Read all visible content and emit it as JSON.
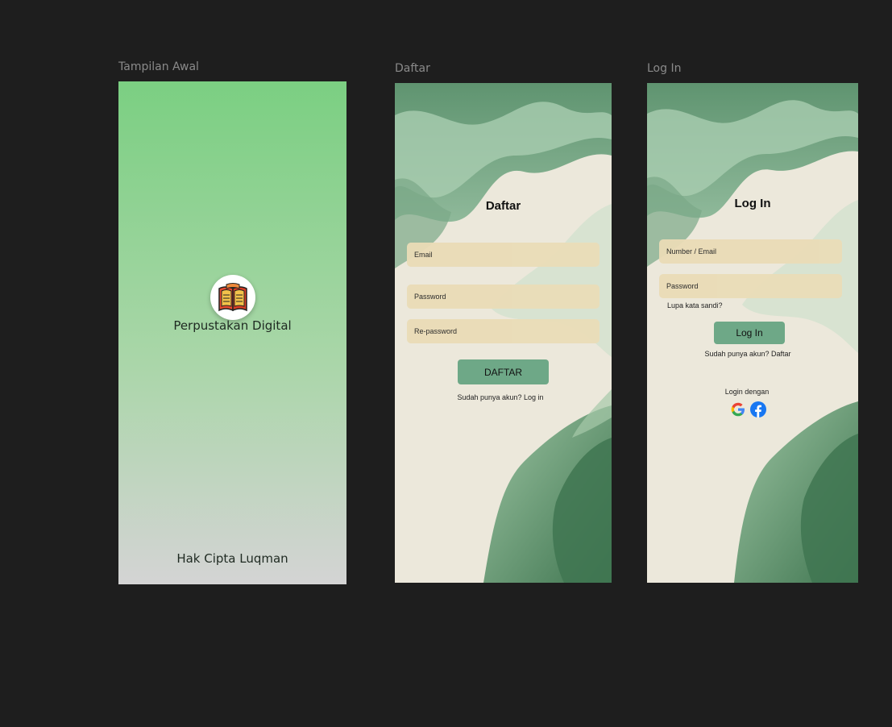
{
  "frames": {
    "splash": {
      "label": "Tampilan Awal",
      "app_name": "Perpustakan Digital",
      "footer": "Hak Cipta Luqman",
      "logo_icon": "book-icon"
    },
    "daftar": {
      "label": "Daftar",
      "title": "Daftar",
      "email_placeholder": "Email",
      "password_placeholder": "Password",
      "repassword_placeholder": "Re-password",
      "submit_label": "DAFTAR",
      "login_link": "Sudah punya akun? Log in"
    },
    "login": {
      "label": "Log In",
      "title": "Log In",
      "identifier_placeholder": "Number / Email",
      "password_placeholder": "Password",
      "forgot_link": "Lupa kata sandi?",
      "submit_label": "Log In",
      "register_link": "Sudah punya akun? Daftar",
      "social_label": "Login dengan",
      "social_icons": [
        "google-icon",
        "facebook-icon"
      ]
    }
  },
  "colors": {
    "canvas": "#1e1e1e",
    "splash_top": "#7bcf82",
    "splash_bottom": "#d4d4d4",
    "input_fill": "#eadcb7",
    "button_fill": "#6ea887",
    "wave_dark": "#4f8460",
    "wave_light": "#ede9dd"
  }
}
